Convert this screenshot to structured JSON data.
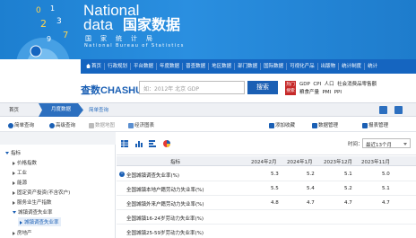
{
  "banner": {
    "logo_line1": "National",
    "logo_line2": "data",
    "logo_cn": "国家数据",
    "subtitle_cn": "国家统计局",
    "subtitle_en": "National Bureau of Statistics",
    "digit_glyphs": [
      "0",
      "1",
      "2",
      "3",
      "7",
      "9"
    ]
  },
  "nav": {
    "items": [
      "首页",
      "行政规划",
      "平台数据",
      "年度数据",
      "普查数据",
      "地区数据",
      "部门数据",
      "国际数据",
      "可视化产品",
      "出版物",
      "统计制度",
      "统计"
    ]
  },
  "search": {
    "logo_cn": "查数",
    "logo_en": "CHASHU",
    "placeholder": "如：2012年 北京 GDP",
    "button": "搜索",
    "hot_badge": "热门搜索",
    "hot_links": [
      "GDP",
      "CPI",
      "人口",
      "社会消费品零售额",
      "粮食产量",
      "PMI",
      "PPI"
    ]
  },
  "breadcrumb": {
    "home": "首页",
    "current": "月度数据",
    "next": "简单查询"
  },
  "toolbar": {
    "left": [
      "简单查询",
      "高级查询",
      "数据地图",
      "经济图表"
    ],
    "right": [
      "添加收藏",
      "数据管理",
      "报表管理"
    ]
  },
  "tree": {
    "root": "指标",
    "items": [
      "价格指数",
      "工业",
      "能源",
      "固定资产投资(不含农户)",
      "服务业生产指数",
      "城镇调查失业率",
      "城镇调查失业率",
      "房地产"
    ]
  },
  "table": {
    "time_label": "时间：",
    "time_value": "最近13个月",
    "headers": [
      "指标",
      "2024年2月",
      "2024年1月",
      "2023年12月",
      "2023年11月"
    ],
    "rows": [
      {
        "name": "全国城镇调查失业率(%)",
        "values": [
          "5.3",
          "5.2",
          "5.1",
          "5.0"
        ],
        "info": true
      },
      {
        "name": "全国城镇本地户籍劳动力失业率(%)",
        "values": [
          "5.5",
          "5.4",
          "5.2",
          "5.1"
        ],
        "info": false
      },
      {
        "name": "全国城镇外来户籍劳动力失业率(%)",
        "values": [
          "4.8",
          "4.7",
          "4.7",
          "4.7"
        ],
        "info": false
      },
      {
        "name": "全国城镇16-24岁劳动力失业率(%)",
        "values": [
          "",
          "",
          "",
          ""
        ],
        "info": false
      },
      {
        "name": "全国城镇25-59岁劳动力失业率(%)",
        "values": [
          "",
          "",
          "",
          ""
        ],
        "info": false
      }
    ]
  },
  "colors": {
    "banner": "#1d7fd0",
    "nav": "#1565c0",
    "accent": "#1a5fb4",
    "hot": "#c62828"
  }
}
